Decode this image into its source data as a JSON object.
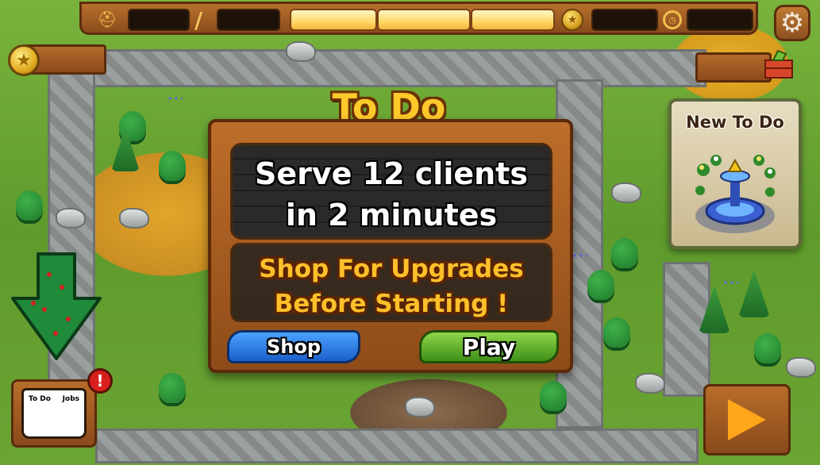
{
  "hud": {
    "stat_a": "",
    "stat_b": "",
    "separator": "/",
    "coins_top": "",
    "timer": "",
    "progress_fraction": 1.0
  },
  "wallet": {
    "coins": "",
    "right_value": ""
  },
  "todo": {
    "title": "To Do",
    "goal_line1": "Serve 12 clients",
    "goal_line2": "in 2 minutes",
    "hint_line1": "Shop For Upgrades",
    "hint_line2": "Before Starting !",
    "shop_label": "Shop",
    "play_label": "Play"
  },
  "side_card": {
    "title": "New To Do"
  },
  "journal": {
    "left_tab": "To Do",
    "right_tab": "Jobs",
    "alert": "!"
  },
  "icons": {
    "helmet": "helmet-icon",
    "coin": "coin-icon",
    "clock": "clock-icon",
    "gear": "gear-icon",
    "arrow": "down-arrow-icon",
    "next": "play-triangle-icon"
  },
  "colors": {
    "title": "#ffc92c",
    "hint": "#ffc02a",
    "shop": "#1b5fc9",
    "play": "#3d8f17",
    "alert": "#d8201c"
  }
}
